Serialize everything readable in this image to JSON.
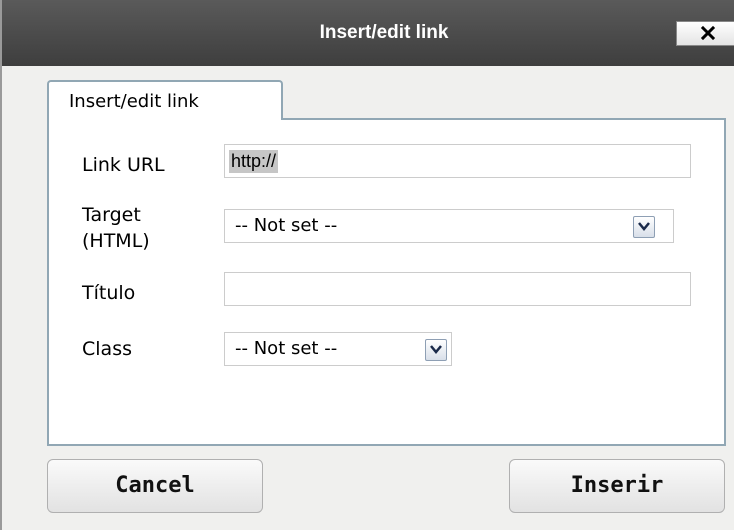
{
  "dialog": {
    "title": "Insert/edit link",
    "close_label": "close"
  },
  "tabs": [
    {
      "label": "Insert/edit link",
      "active": true
    }
  ],
  "form": {
    "link_url": {
      "label": "Link URL",
      "value": "http://"
    },
    "target": {
      "label_line1": "Target",
      "label_line2": "(HTML)",
      "value": "-- Not set --"
    },
    "titulo": {
      "label": "Título",
      "value": ""
    },
    "class": {
      "label": "Class",
      "value": "-- Not set --"
    }
  },
  "buttons": {
    "cancel": "Cancel",
    "insert": "Inserir"
  },
  "colors": {
    "titlebar": "#454545",
    "panel_border": "#91a7b4",
    "dialog_bg": "#f0f0ee",
    "selection_highlight": "#c6c6c6"
  },
  "icons": {
    "close": "close-icon",
    "dropdown": "chevron-down-icon"
  }
}
